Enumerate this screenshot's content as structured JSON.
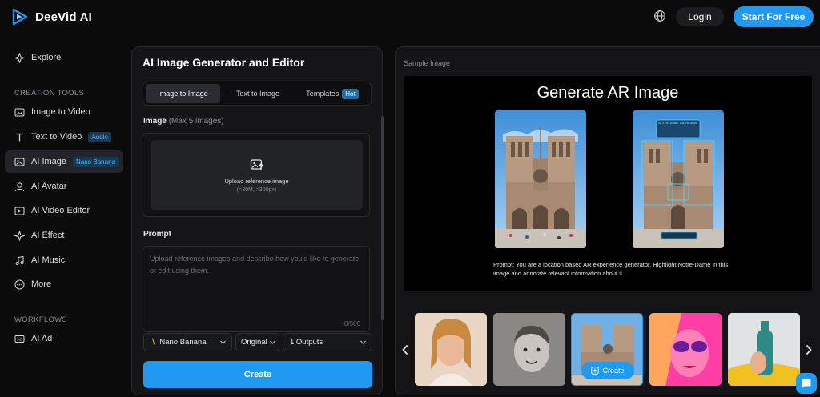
{
  "header": {
    "brand": "DeeVid AI",
    "login_label": "Login",
    "start_label": "Start For Free"
  },
  "sidebar": {
    "explore": "Explore",
    "creation_title": "CREATION TOOLS",
    "items": [
      {
        "label": "Image to Video",
        "icon": "image-video-icon"
      },
      {
        "label": "Text to Video",
        "icon": "text-icon",
        "badge": "Audio"
      },
      {
        "label": "AI Image",
        "icon": "ai-image-icon",
        "badge": "Nano Banana",
        "active": true
      },
      {
        "label": "AI Avatar",
        "icon": "avatar-icon"
      },
      {
        "label": "AI Video Editor",
        "icon": "video-editor-icon"
      },
      {
        "label": "AI Effect",
        "icon": "sparkle-icon"
      },
      {
        "label": "AI Music",
        "icon": "music-icon"
      },
      {
        "label": "More",
        "icon": "more-icon"
      }
    ],
    "workflows_title": "WORKFLOWS",
    "workflow_items": [
      {
        "label": "AI Ad",
        "icon": "ad-icon"
      }
    ]
  },
  "editor": {
    "title": "AI Image Generator and Editor",
    "tabs": [
      {
        "label": "Image to Image",
        "active": true
      },
      {
        "label": "Text to Image"
      },
      {
        "label": "Templates",
        "badge": "Hot"
      }
    ],
    "image_label": "Image",
    "image_sublabel": "(Max 5 images)",
    "upload_title": "Upload reference image",
    "upload_sub": "(<30M, >300px)",
    "prompt_label": "Prompt",
    "prompt_placeholder": "Upload reference images and describe how you'd like to generate or edit using them.",
    "prompt_counter": "0/500",
    "model_select": "Nano Banana",
    "ratio_select": "Original",
    "outputs_select": "1 Outputs",
    "create_label": "Create"
  },
  "sample": {
    "label": "Sample Image",
    "title": "Generate AR Image",
    "prompt_text": "Prompt: You are a location based AR experience generator. Highlight Notre-Dame in this image and annotate relevant information about it.",
    "ar_card_text": "NOTRE-DAME CATHEDRAL",
    "thumb_create_label": "Create"
  },
  "colors": {
    "accent": "#1f9af0",
    "background": "#0b0b0c",
    "panel": "#151517"
  }
}
